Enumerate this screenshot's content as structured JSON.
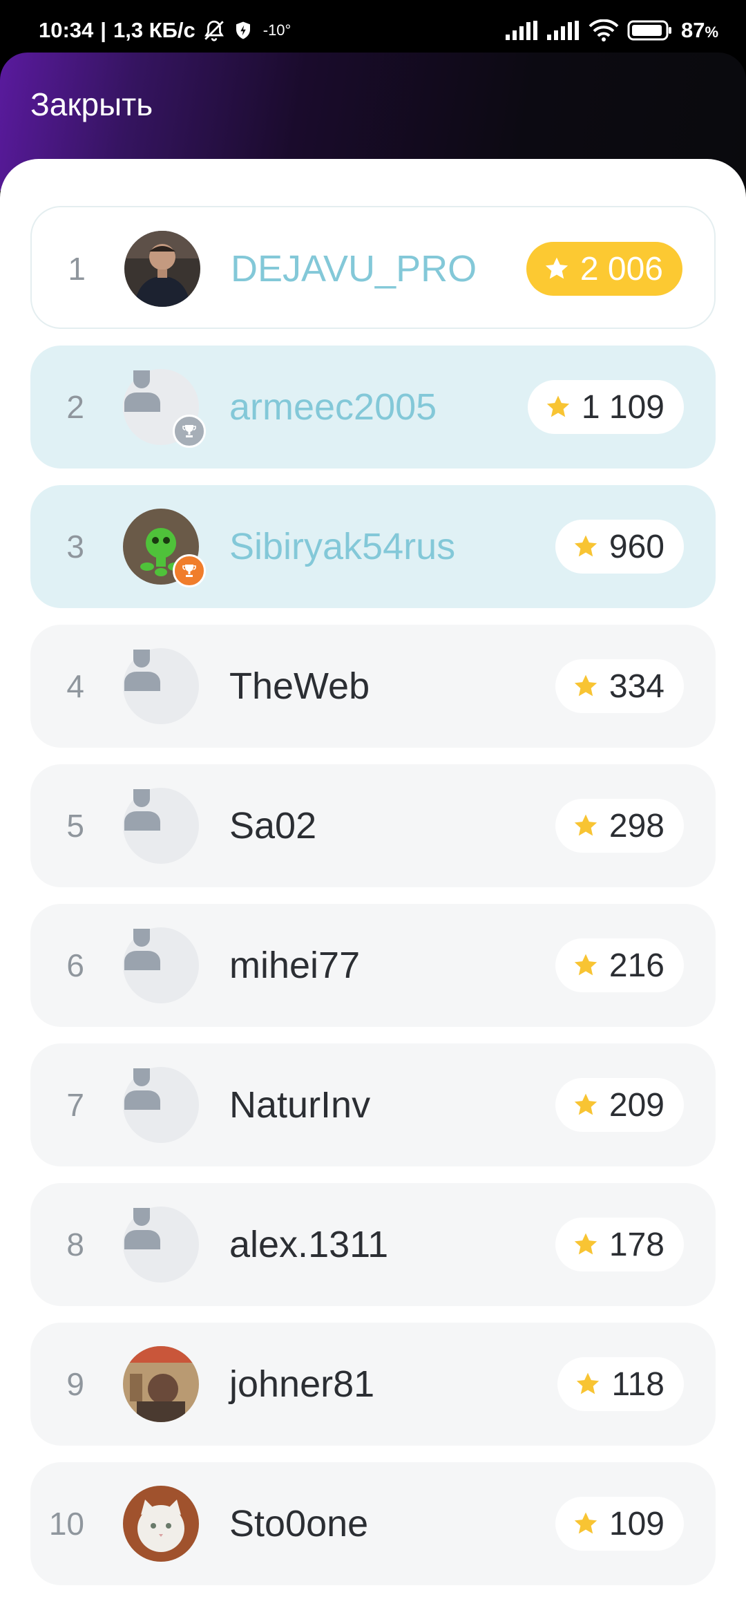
{
  "status_bar": {
    "time": "10:34",
    "separator": "|",
    "speed": "1,3 КБ/с",
    "temperature": "-10°",
    "battery": "87",
    "battery_unit": "%"
  },
  "header": {
    "close_label": "Закрыть"
  },
  "colors": {
    "gold": "#fcc932",
    "star": "#f8c433",
    "name_top": "#83c8d8",
    "highlight": "#e0f1f5",
    "orange_badge": "#f07d2b"
  },
  "leaderboard": [
    {
      "rank": "1",
      "name": "DEJAVU_PRO",
      "score": "2 006",
      "avatar": "photo-man",
      "highlight": false
    },
    {
      "rank": "2",
      "name": "armeec2005",
      "score": "1 109",
      "avatar": "placeholder-trophy-grey",
      "highlight": true
    },
    {
      "rank": "3",
      "name": "Sibiryak54rus",
      "score": "960",
      "avatar": "photo-green-toy-trophy-orange",
      "highlight": true
    },
    {
      "rank": "4",
      "name": "TheWeb",
      "score": "334",
      "avatar": "placeholder"
    },
    {
      "rank": "5",
      "name": "Sa02",
      "score": "298",
      "avatar": "placeholder"
    },
    {
      "rank": "6",
      "name": "mihei77",
      "score": "216",
      "avatar": "placeholder"
    },
    {
      "rank": "7",
      "name": "NaturInv",
      "score": "209",
      "avatar": "placeholder"
    },
    {
      "rank": "8",
      "name": "alex.1311",
      "score": "178",
      "avatar": "placeholder"
    },
    {
      "rank": "9",
      "name": "johner81",
      "score": "118",
      "avatar": "photo-poster"
    },
    {
      "rank": "10",
      "name": "Sto0one",
      "score": "109",
      "avatar": "photo-cat"
    }
  ]
}
